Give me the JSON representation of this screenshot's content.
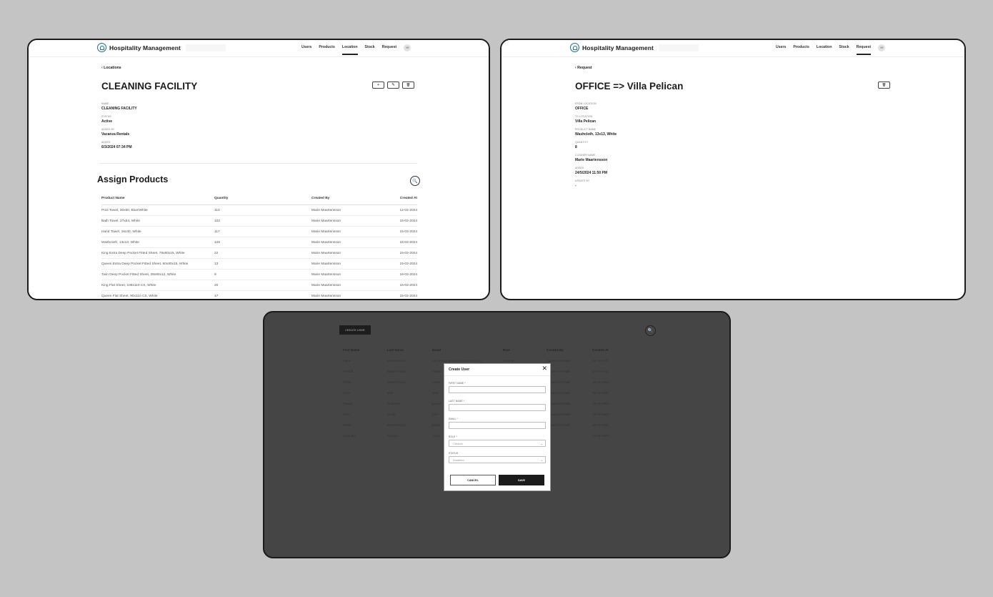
{
  "app": {
    "brand": "Hospitality Management",
    "nav": [
      "Users",
      "Products",
      "Location",
      "Stock",
      "Request"
    ],
    "avatar": "VR"
  },
  "location_page": {
    "back": "Locations",
    "title": "CLEANING FACILITY",
    "actions": [
      "+",
      "✎",
      "🗑"
    ],
    "fields": [
      {
        "label": "NAME",
        "value": "CLEANING FACILITY"
      },
      {
        "label": "STATUS",
        "value": "Active"
      },
      {
        "label": "ADDED BY",
        "value": "Vacanza Rentals"
      },
      {
        "label": "ADDED",
        "value": "6/3/2024 07:34 PM"
      }
    ],
    "section_title": "Assign Products",
    "table": {
      "headers": [
        "Product Name",
        "Quantity",
        "Created By",
        "Created At"
      ],
      "rows": [
        [
          "Pool Towel, 30x60, Blue/White",
          "110",
          "Marie Maartensson",
          "12-03-2024"
        ],
        [
          "Bath Towel, 27x54, White",
          "102",
          "Marie Maartensson",
          "15-03-2024"
        ],
        [
          "Hand Towel, 16x30, White",
          "117",
          "Marie Maartensson",
          "15-03-2024"
        ],
        [
          "Washcloth, 13x13, White",
          "126",
          "Marie Maartensson",
          "15-03-2024"
        ],
        [
          "King Extra Deep Pocket Fitted Sheet, 78x80x15, White",
          "22",
          "Marie Maartensson",
          "15-03-2024"
        ],
        [
          "Queen Extra Deep Pocket Fitted Sheet, 60x80x15, White",
          "13",
          "Marie Maartensson",
          "15-03-2024"
        ],
        [
          "Twin Deep Pocket Fitted Sheet, 39x80x12, White",
          "9",
          "Marie Maartensson",
          "18-03-2024"
        ],
        [
          "King Flat Sheet, 108x110 CS, White",
          "20",
          "Marie Maartensson",
          "15-03-2024"
        ],
        [
          "Queen Flat Sheet, 90x110 CS, White",
          "17",
          "Marie Maartensson",
          "15-03-2024"
        ]
      ]
    }
  },
  "request_page": {
    "back": "Request",
    "title": "OFFICE => Villa Pelican",
    "actions": [
      "🗑"
    ],
    "fields": [
      {
        "label": "FROM LOCATION",
        "value": "OFFICE"
      },
      {
        "label": "TO LOCATION",
        "value": "Villa Pelican"
      },
      {
        "label": "PRODUCT NAME",
        "value": "Washcloth, 13x13, White"
      },
      {
        "label": "QUANTITY",
        "value": "8"
      },
      {
        "label": "CLEANER NAME",
        "value": "Marie Maartensson"
      },
      {
        "label": "ADDED",
        "value": "24/5/2024 11:50 PM"
      },
      {
        "label": "UPDATE BY",
        "value": "-"
      }
    ]
  },
  "users_page": {
    "create_button": "CREATE USER",
    "table": {
      "headers": [
        "First Name",
        "Last Name",
        "Email",
        "Role",
        "Created By",
        "Created At",
        ""
      ],
      "rows": [
        [
          "Marie",
          "Maartensson",
          "mariemaartensson@vacanza.com",
          "Cleaner",
          "Vacanza Rentals",
          "11-03-2024",
          "›"
        ],
        [
          "Fredrik",
          "Maartensson",
          "fredrik",
          "",
          "Vacanza Rentals",
          "06-03-2024",
          "›"
        ],
        [
          "Patrik",
          "Maartensson",
          "patrik",
          "",
          "Vacanza Rentals",
          "06-03-2024",
          "›"
        ],
        [
          "Jane",
          "Doe",
          "jane",
          "",
          "Vacanza Rentals",
          "06-03-2024",
          "›"
        ],
        [
          "Pauwli",
          "Chauhan",
          "pauwli",
          "",
          "Vacanza Rentals",
          "06-03-2024",
          "›"
        ],
        [
          "John",
          "Smith",
          "john",
          "",
          "Vacanza Rentals",
          "06-03-2024",
          "›"
        ],
        [
          "Pablo",
          "Maartensson",
          "pablo",
          "",
          "Vacanza Rentals",
          "06-03-2024",
          "›"
        ],
        [
          "Veronika",
          "Renton",
          "veron",
          "",
          "",
          "24-03-2024",
          "›"
        ]
      ]
    },
    "modal": {
      "title": "Create User",
      "close": "✕",
      "fields": [
        {
          "label": "FIRST NAME *",
          "value": ""
        },
        {
          "label": "LAST NAME *",
          "value": ""
        },
        {
          "label": "EMAIL *",
          "value": ""
        },
        {
          "label": "ROLE *",
          "value": "Cleaner"
        },
        {
          "label": "STATUS",
          "value": "Disabled"
        }
      ],
      "cancel": "CANCEL",
      "save": "SAVE"
    }
  },
  "colors": {
    "background": "#c4c4c4",
    "overlay": "#454545",
    "primary": "#1b1b1b",
    "logo": "#2b6c86"
  }
}
